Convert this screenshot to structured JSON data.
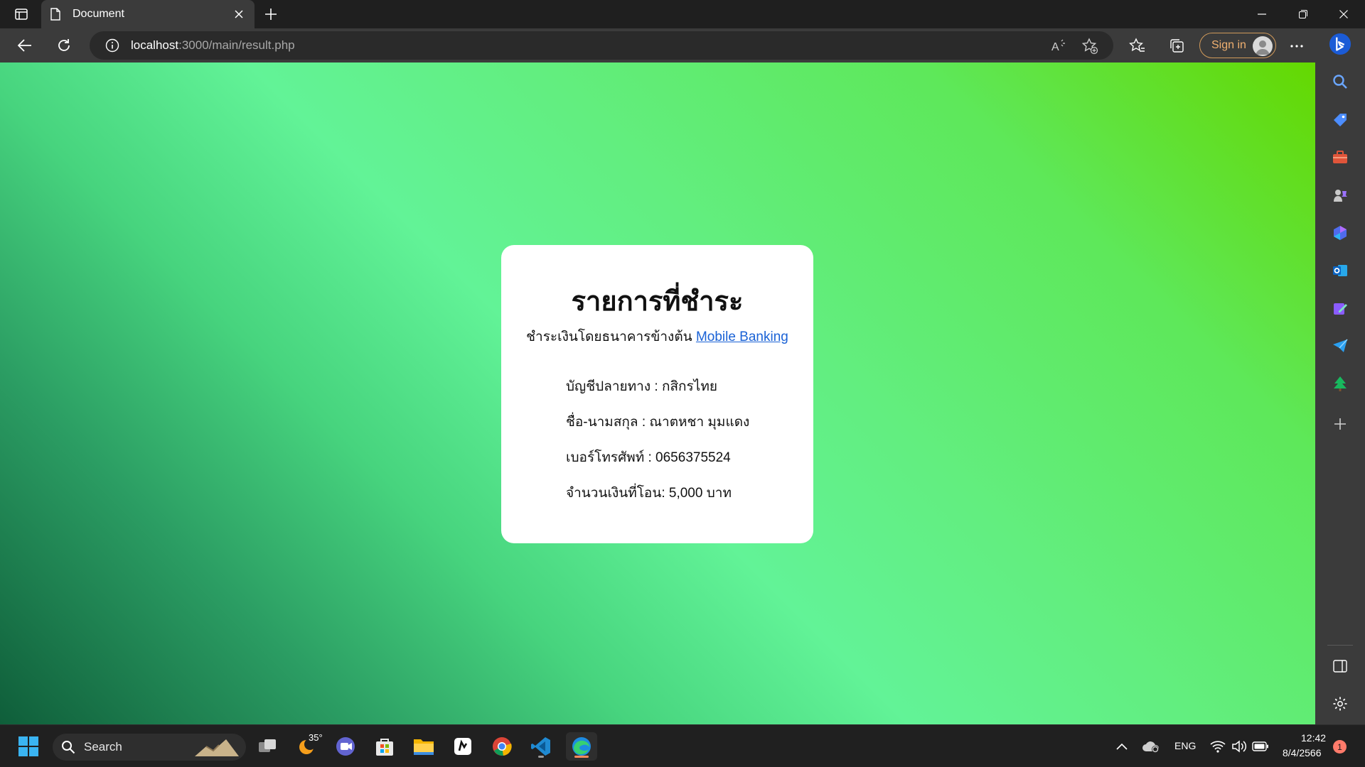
{
  "browser": {
    "tab_title": "Document",
    "url_host": "localhost",
    "url_path": ":3000/main/result.php",
    "signin_label": "Sign in"
  },
  "page": {
    "heading": "รายการที่ชำระ",
    "subtitle_prefix": "ชำระเงินโดยธนาคารข้างต้น",
    "subtitle_link": "Mobile Banking",
    "rows": [
      "บัญชีปลายทาง : กสิกรไทย",
      "ชื่อ-นามสกุล : ณาตหชา มุมแดง",
      "เบอร์โทรศัพท์ : 0656375524",
      "จำนวนเงินที่โอน: 5,000 บาท"
    ]
  },
  "taskbar": {
    "search_label": "Search",
    "weather_temp": "35°",
    "lang": "ENG",
    "time": "12:42",
    "date": "8/4/2566",
    "notification_count": "1"
  },
  "colors": {
    "link": "#1a62d6",
    "accent_signin": "#f0b070"
  }
}
